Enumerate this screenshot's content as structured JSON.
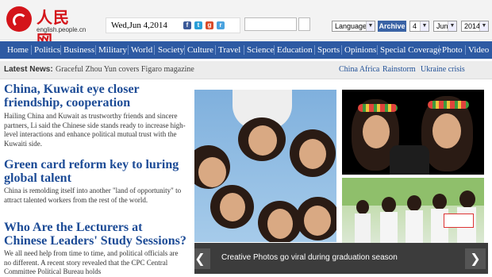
{
  "header": {
    "logo_cn": "人民网",
    "logo_url": "english.people.cn",
    "date": "Wed,Jun 4,2014",
    "languages": "Languages",
    "archive": "Archive",
    "archive_day": "4",
    "archive_month": "Jun",
    "archive_year": "2014",
    "social_icons": [
      "facebook-icon",
      "twitter-icon",
      "google-plus-icon",
      "rss-icon"
    ]
  },
  "nav": {
    "items": [
      "Home",
      "Politics",
      "Business",
      "Military",
      "World",
      "Society",
      "Culture",
      "Travel",
      "Science",
      "Education",
      "Sports",
      "Opinions",
      "Special Coverage",
      "Photo",
      "Video"
    ]
  },
  "latest_news": {
    "label": "Latest News:",
    "headline": "Graceful Zhou Yun covers Figaro magazine",
    "hot_links": [
      "China Africa",
      "Rainstorm",
      "Ukraine crisis"
    ]
  },
  "articles": [
    {
      "headline": "China, Kuwait eye closer friendship, cooperation",
      "summary": "Hailing China and Kuwait as trustworthy friends and sincere partners, Li said the Chinese side stands ready to increase high-level interactions and enhance political mutual trust with the Kuwaiti side."
    },
    {
      "headline": "Green card reform key to luring global talent",
      "summary": "China is remolding itself into another \"land of opportunity\" to attract talented workers from the rest of the world."
    },
    {
      "headline": "Who Are the Lecturers at Chinese Leaders' Study Sessions?",
      "summary": "We all need help from time to time, and political officials are no different. A recent story revealed that the CPC Central Committee Political Bureau holds"
    }
  ],
  "slideshow": {
    "caption": "Creative Photos go viral during graduation season",
    "prev": "❮",
    "next": "❯"
  },
  "colors": {
    "brand_red": "#d4141a",
    "nav_blue": "#2d5aa3",
    "headline_blue": "#1c4b96"
  }
}
